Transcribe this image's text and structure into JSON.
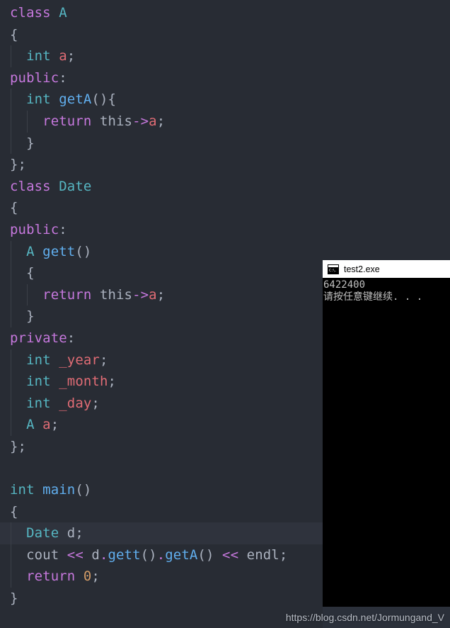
{
  "editor": {
    "background_color": "#282c34",
    "highlight_line_color": "#2f333d",
    "highlighted_line_index": 25,
    "colors": {
      "keyword": "#c678dd",
      "type": "#56b6c2",
      "function": "#61afef",
      "variable": "#e06c75",
      "plain": "#abb2bf",
      "number": "#d19a66",
      "indent_guide": "#3b4048"
    },
    "lines": [
      {
        "indent": 0,
        "tokens": [
          {
            "t": "class",
            "c": "kw"
          },
          {
            "t": " ",
            "c": "pl"
          },
          {
            "t": "A",
            "c": "type"
          }
        ]
      },
      {
        "indent": 0,
        "tokens": [
          {
            "t": "{",
            "c": "punc"
          }
        ]
      },
      {
        "indent": 1,
        "tokens": [
          {
            "t": "int",
            "c": "type"
          },
          {
            "t": " ",
            "c": "pl"
          },
          {
            "t": "a",
            "c": "var"
          },
          {
            "t": ";",
            "c": "punc"
          }
        ]
      },
      {
        "indent": 0,
        "tokens": [
          {
            "t": "public",
            "c": "kw"
          },
          {
            "t": ":",
            "c": "punc"
          }
        ]
      },
      {
        "indent": 1,
        "tokens": [
          {
            "t": "int",
            "c": "type"
          },
          {
            "t": " ",
            "c": "pl"
          },
          {
            "t": "getA",
            "c": "fn"
          },
          {
            "t": "(){",
            "c": "punc"
          }
        ]
      },
      {
        "indent": 2,
        "tokens": [
          {
            "t": "return",
            "c": "kw"
          },
          {
            "t": " ",
            "c": "pl"
          },
          {
            "t": "this",
            "c": "pl"
          },
          {
            "t": "->",
            "c": "op"
          },
          {
            "t": "a",
            "c": "var"
          },
          {
            "t": ";",
            "c": "punc"
          }
        ]
      },
      {
        "indent": 1,
        "tokens": [
          {
            "t": "}",
            "c": "punc"
          }
        ]
      },
      {
        "indent": 0,
        "tokens": [
          {
            "t": "};",
            "c": "punc"
          }
        ]
      },
      {
        "indent": 0,
        "tokens": [
          {
            "t": "class",
            "c": "kw"
          },
          {
            "t": " ",
            "c": "pl"
          },
          {
            "t": "Date",
            "c": "type"
          }
        ]
      },
      {
        "indent": 0,
        "tokens": [
          {
            "t": "{",
            "c": "punc"
          }
        ]
      },
      {
        "indent": 0,
        "tokens": [
          {
            "t": "public",
            "c": "kw"
          },
          {
            "t": ":",
            "c": "punc"
          }
        ]
      },
      {
        "indent": 1,
        "tokens": [
          {
            "t": "A",
            "c": "type"
          },
          {
            "t": " ",
            "c": "pl"
          },
          {
            "t": "gett",
            "c": "fn"
          },
          {
            "t": "()",
            "c": "punc"
          }
        ]
      },
      {
        "indent": 1,
        "tokens": [
          {
            "t": "{",
            "c": "punc"
          }
        ]
      },
      {
        "indent": 2,
        "tokens": [
          {
            "t": "return",
            "c": "kw"
          },
          {
            "t": " ",
            "c": "pl"
          },
          {
            "t": "this",
            "c": "pl"
          },
          {
            "t": "->",
            "c": "op"
          },
          {
            "t": "a",
            "c": "var"
          },
          {
            "t": ";",
            "c": "punc"
          }
        ]
      },
      {
        "indent": 1,
        "tokens": [
          {
            "t": "}",
            "c": "punc"
          }
        ]
      },
      {
        "indent": 0,
        "tokens": [
          {
            "t": "private",
            "c": "kw"
          },
          {
            "t": ":",
            "c": "punc"
          }
        ]
      },
      {
        "indent": 1,
        "tokens": [
          {
            "t": "int",
            "c": "type"
          },
          {
            "t": " ",
            "c": "pl"
          },
          {
            "t": "_year",
            "c": "var"
          },
          {
            "t": ";",
            "c": "punc"
          }
        ]
      },
      {
        "indent": 1,
        "tokens": [
          {
            "t": "int",
            "c": "type"
          },
          {
            "t": " ",
            "c": "pl"
          },
          {
            "t": "_month",
            "c": "var"
          },
          {
            "t": ";",
            "c": "punc"
          }
        ]
      },
      {
        "indent": 1,
        "tokens": [
          {
            "t": "int",
            "c": "type"
          },
          {
            "t": " ",
            "c": "pl"
          },
          {
            "t": "_day",
            "c": "var"
          },
          {
            "t": ";",
            "c": "punc"
          }
        ]
      },
      {
        "indent": 1,
        "tokens": [
          {
            "t": "A",
            "c": "type"
          },
          {
            "t": " ",
            "c": "pl"
          },
          {
            "t": "a",
            "c": "var"
          },
          {
            "t": ";",
            "c": "punc"
          }
        ]
      },
      {
        "indent": 0,
        "tokens": [
          {
            "t": "};",
            "c": "punc"
          }
        ]
      },
      {
        "indent": 0,
        "tokens": []
      },
      {
        "indent": 0,
        "tokens": [
          {
            "t": "int",
            "c": "type"
          },
          {
            "t": " ",
            "c": "pl"
          },
          {
            "t": "main",
            "c": "fn"
          },
          {
            "t": "()",
            "c": "punc"
          }
        ]
      },
      {
        "indent": 0,
        "tokens": [
          {
            "t": "{",
            "c": "punc"
          }
        ]
      },
      {
        "indent": 1,
        "tokens": [
          {
            "t": "Date",
            "c": "type"
          },
          {
            "t": " ",
            "c": "pl"
          },
          {
            "t": "d",
            "c": "pl"
          },
          {
            "t": ";",
            "c": "punc"
          }
        ],
        "highlight": true
      },
      {
        "indent": 1,
        "tokens": [
          {
            "t": "cout",
            "c": "pl"
          },
          {
            "t": " ",
            "c": "pl"
          },
          {
            "t": "<<",
            "c": "op"
          },
          {
            "t": " d",
            "c": "pl"
          },
          {
            "t": ".",
            "c": "op"
          },
          {
            "t": "gett",
            "c": "fn"
          },
          {
            "t": "()",
            "c": "punc"
          },
          {
            "t": ".",
            "c": "op"
          },
          {
            "t": "getA",
            "c": "fn"
          },
          {
            "t": "()",
            "c": "punc"
          },
          {
            "t": " ",
            "c": "pl"
          },
          {
            "t": "<<",
            "c": "op"
          },
          {
            "t": " endl;",
            "c": "pl"
          }
        ]
      },
      {
        "indent": 1,
        "tokens": [
          {
            "t": "return",
            "c": "kw"
          },
          {
            "t": " ",
            "c": "pl"
          },
          {
            "t": "0",
            "c": "num"
          },
          {
            "t": ";",
            "c": "punc"
          }
        ]
      },
      {
        "indent": 0,
        "tokens": [
          {
            "t": "}",
            "c": "punc"
          }
        ]
      }
    ]
  },
  "console_window": {
    "title": "test2.exe",
    "icon": "console-cmd-icon",
    "icon_glyph": "C:\\.",
    "titlebar_background": "#ffffff",
    "background": "#000000",
    "text_color": "#c0c0c0",
    "output_lines": [
      "6422400",
      "请按任意键继续. . ."
    ]
  },
  "watermark": {
    "text": "https://blog.csdn.net/Jormungand_V"
  }
}
